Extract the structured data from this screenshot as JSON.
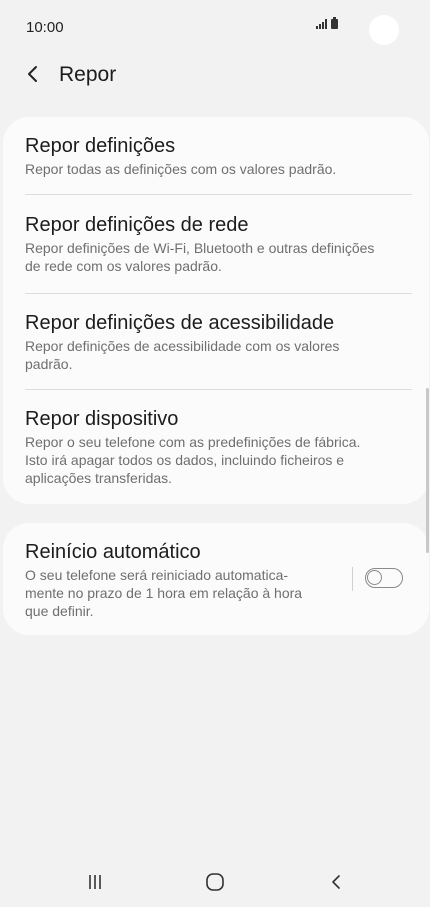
{
  "status_bar": {
    "time": "10:00",
    "icons": [
      "signal-icon",
      "battery-icon"
    ]
  },
  "header": {
    "title": "Repor",
    "back_icon": "chevron-left-icon"
  },
  "reset_items": [
    {
      "title": "Repor definições",
      "description": "Repor todas as definições com os valores padrão."
    },
    {
      "title": "Repor definições de rede",
      "description_lines": [
        "Repor definições de Wi-Fi, Bluetooth e outras definições",
        "de rede com os valores padrão."
      ]
    },
    {
      "title": "Repor definições de acessibilidade",
      "description_lines": [
        "Repor definições de acessibilidade com os valores",
        "padrão."
      ]
    },
    {
      "title": "Repor dispositivo",
      "description_lines": [
        "Repor o seu telefone com as predefinições de fábrica.",
        "Isto irá apagar todos os dados, incluindo ficheiros e",
        "aplicações transferidas."
      ]
    }
  ],
  "auto_restart": {
    "title": "Reinício automático",
    "description_lines": [
      "O seu telefone será reiniciado automatica-",
      "mente no prazo de 1 hora em relação à hora",
      "que definir."
    ],
    "toggle_on": false
  },
  "nav_bar": {
    "icons": [
      "recents-icon",
      "home-icon",
      "back-icon"
    ]
  },
  "colors": {
    "background": "#f2f2f2",
    "card": "#fbfbfb",
    "title_text": "#1c1c1c",
    "secondary_text": "#6f6f6f"
  }
}
